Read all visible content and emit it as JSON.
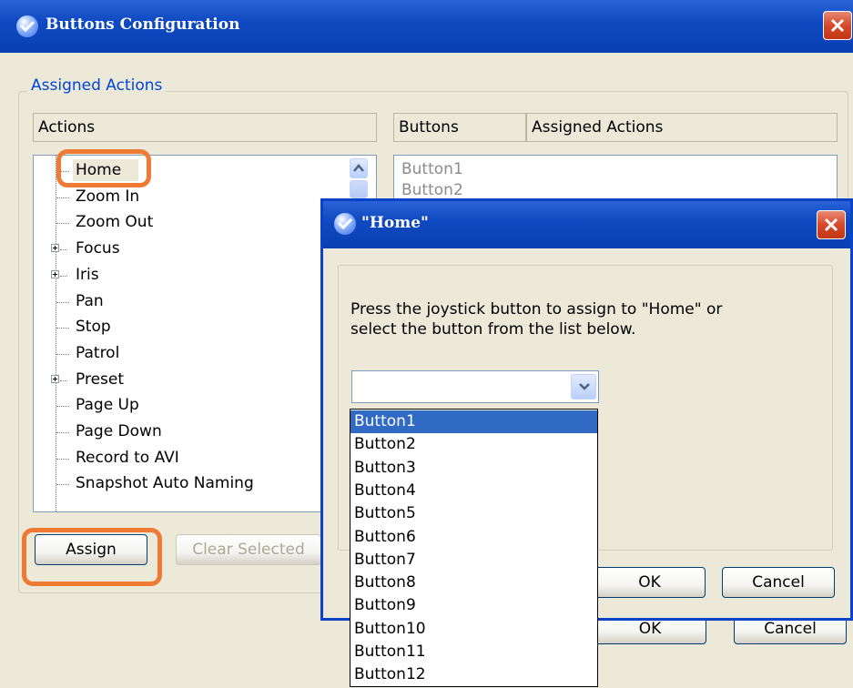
{
  "main_window": {
    "title": "Buttons Configuration",
    "group_label": "Assigned Actions",
    "actions_header": "Actions",
    "buttons_header": "Buttons",
    "assigned_actions_header": "Assigned Actions",
    "tree_items": [
      {
        "label": "Home",
        "expandable": false,
        "selected": true
      },
      {
        "label": "Zoom In",
        "expandable": false
      },
      {
        "label": "Zoom Out",
        "expandable": false
      },
      {
        "label": "Focus",
        "expandable": true
      },
      {
        "label": "Iris",
        "expandable": true
      },
      {
        "label": "Pan",
        "expandable": false
      },
      {
        "label": "Stop",
        "expandable": false
      },
      {
        "label": "Patrol",
        "expandable": false
      },
      {
        "label": "Preset",
        "expandable": true
      },
      {
        "label": "Page Up",
        "expandable": false
      },
      {
        "label": "Page Down",
        "expandable": false
      },
      {
        "label": "Record to AVI",
        "expandable": false
      },
      {
        "label": "Snapshot Auto Naming",
        "expandable": false
      }
    ],
    "buttons_list": [
      "Button1",
      "Button2"
    ],
    "assign_button": "Assign",
    "clear_selected_button": "Clear Selected",
    "ok_button": "OK",
    "cancel_button": "Cancel"
  },
  "dialog": {
    "title": "\"Home\"",
    "message_line1": "Press the joystick button to assign to \"Home\" or",
    "message_line2": "select the button from the list below.",
    "dropdown_value": "",
    "dropdown_options": [
      "Button1",
      "Button2",
      "Button3",
      "Button4",
      "Button5",
      "Button6",
      "Button7",
      "Button8",
      "Button9",
      "Button10",
      "Button11",
      "Button12"
    ],
    "ok_button": "OK",
    "cancel_button": "Cancel"
  },
  "colors": {
    "titlebar": "#0a3fb3",
    "highlight": "#ee7a34",
    "selection": "#316ac5",
    "group_label": "#0046d5"
  },
  "icons": {
    "app_icon": "check-shield-icon",
    "close": "close-icon",
    "scroll_up": "chevron-up-icon",
    "dropdown": "chevron-down-icon",
    "expand": "plus-box-icon"
  }
}
